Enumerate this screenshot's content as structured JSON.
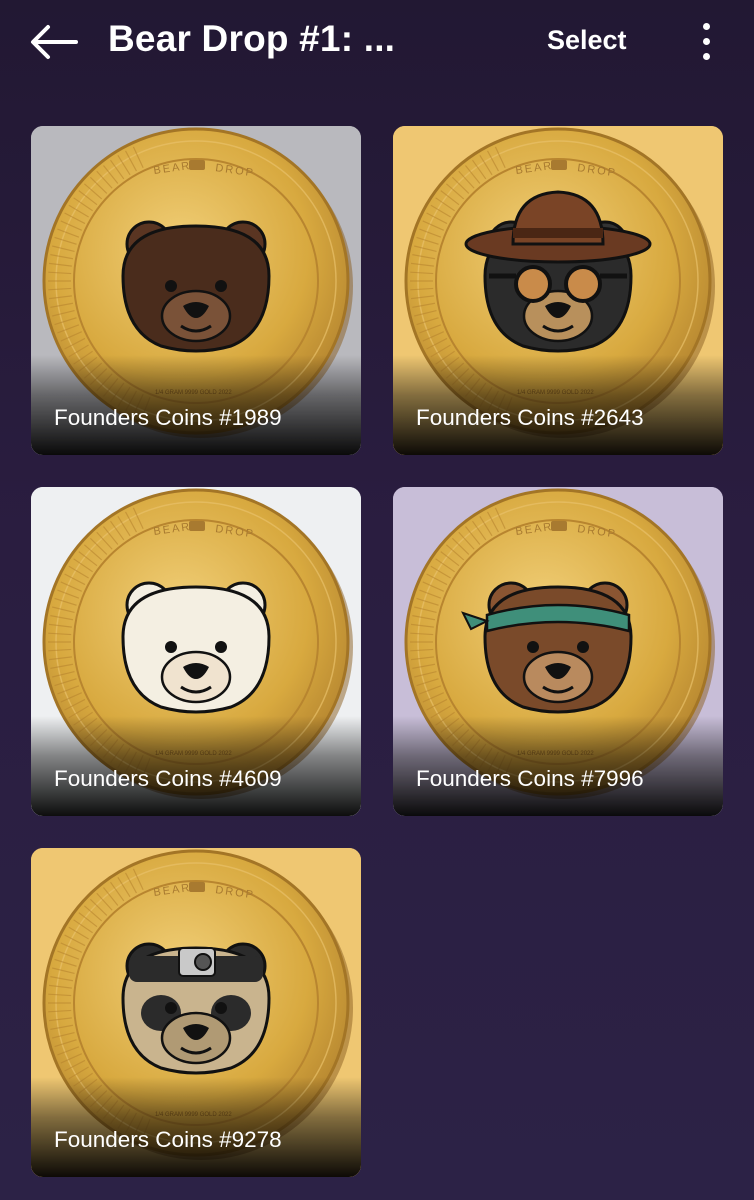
{
  "header": {
    "title": "Bear Drop #1: ...",
    "select_label": "Select",
    "back_icon": "arrow-left-icon",
    "more_icon": "more-vertical-icon"
  },
  "coin_text": {
    "brand_left": "BEAR",
    "brand_right": "DROP",
    "weight_text": "1/4 GRAM 9999 GOLD 2022"
  },
  "items": [
    {
      "label": "Founders Coins #1989",
      "bg": "#b9b9be",
      "bear": "brown"
    },
    {
      "label": "Founders Coins #2643",
      "bg": "#efc772",
      "bear": "black-hat-goggles"
    },
    {
      "label": "Founders Coins #4609",
      "bg": "#eef0f2",
      "bear": "polar"
    },
    {
      "label": "Founders Coins #7996",
      "bg": "#c8bed8",
      "bear": "brown-bandana"
    },
    {
      "label": "Founders Coins #9278",
      "bg": "#efc772",
      "bear": "panda-camera"
    }
  ]
}
